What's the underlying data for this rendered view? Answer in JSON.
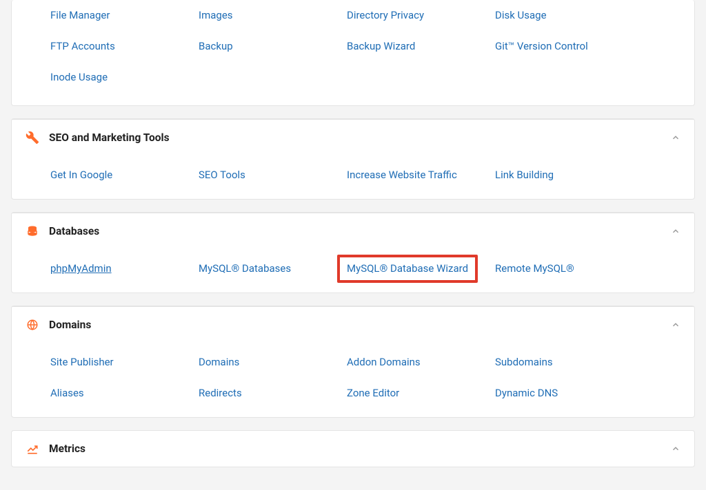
{
  "files_section": {
    "items": [
      "File Manager",
      "Images",
      "Directory Privacy",
      "Disk Usage",
      "FTP Accounts",
      "Backup",
      "Backup Wizard",
      "Git™ Version Control",
      "Inode Usage"
    ]
  },
  "seo_section": {
    "title": "SEO and Marketing Tools",
    "items": [
      "Get In Google",
      "SEO Tools",
      "Increase Website Traffic",
      "Link Building"
    ]
  },
  "databases_section": {
    "title": "Databases",
    "items": [
      "phpMyAdmin",
      "MySQL® Databases",
      "MySQL® Database Wizard",
      "Remote MySQL®"
    ]
  },
  "domains_section": {
    "title": "Domains",
    "items": [
      "Site Publisher",
      "Domains",
      "Addon Domains",
      "Subdomains",
      "Aliases",
      "Redirects",
      "Zone Editor",
      "Dynamic DNS"
    ]
  },
  "metrics_section": {
    "title": "Metrics"
  }
}
